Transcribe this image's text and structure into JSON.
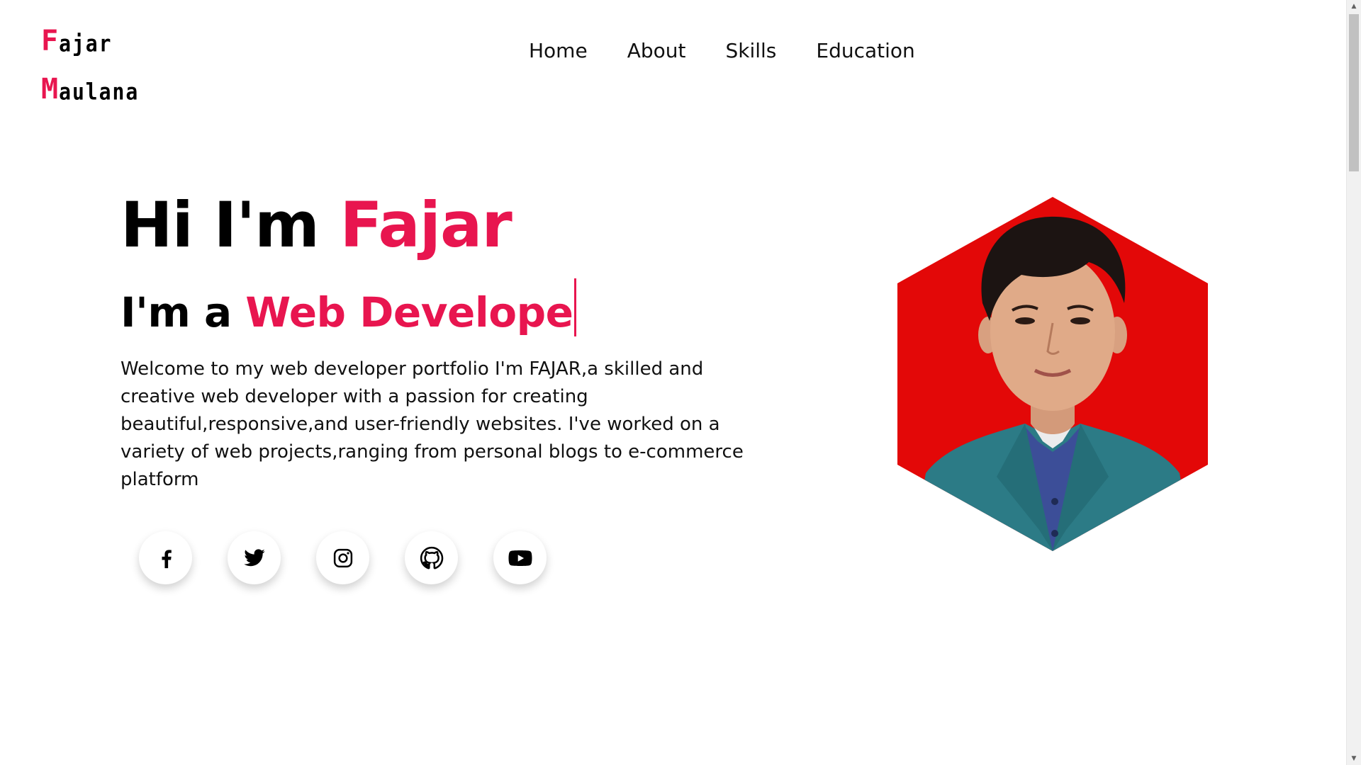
{
  "colors": {
    "accent": "#e8154f",
    "text": "#000000",
    "hexagon_bg": "#e30808"
  },
  "logo": {
    "line1_first": "F",
    "line1_rest": "ajar",
    "line2_first": "M",
    "line2_rest": "aulana"
  },
  "nav": {
    "items": [
      {
        "label": "Home"
      },
      {
        "label": "About"
      },
      {
        "label": "Skills"
      },
      {
        "label": "Education"
      }
    ]
  },
  "hero": {
    "greeting": "Hi I'm ",
    "name": "Fajar",
    "sub_prefix": "I'm a ",
    "sub_typed": "Web Develope",
    "description": "Welcome to my web developer portfolio I'm FAJAR,a skilled and creative web developer with a passion for creating beautiful,responsive,and user-friendly websites. I've worked on a variety of web projects,ranging from personal blogs to e-commerce platform"
  },
  "social": [
    {
      "icon": "facebook-icon"
    },
    {
      "icon": "twitter-icon"
    },
    {
      "icon": "instagram-icon"
    },
    {
      "icon": "github-icon"
    },
    {
      "icon": "youtube-icon"
    }
  ],
  "scrollbar": {
    "up_arrow": "▲",
    "down_arrow": "▼"
  }
}
